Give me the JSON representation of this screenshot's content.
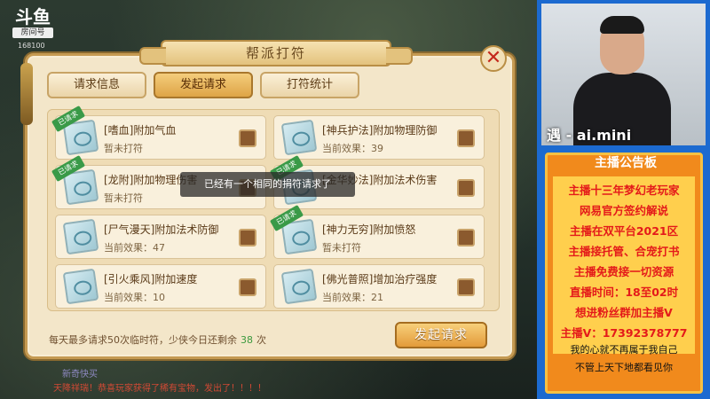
{
  "stream": {
    "logo": "斗鱼",
    "logo_sub": "房间号",
    "room_number": "168100",
    "ticker": "天降祥瑞！恭喜玩家获得了稀有宝物，发出了！！！！",
    "ticker_faint": "新奇快买"
  },
  "dialog": {
    "title": "帮派打符",
    "close_icon": "close-icon",
    "tabs": [
      {
        "label": "请求信息",
        "active": false
      },
      {
        "label": "发起请求",
        "active": true
      },
      {
        "label": "打符统计",
        "active": false
      }
    ],
    "cards": [
      {
        "name": "[嗜血]附加气血",
        "effect": "暂未打符",
        "ribbon": "已请求"
      },
      {
        "name": "[神兵护法]附加物理防御",
        "effect": "当前效果：39",
        "ribbon": ""
      },
      {
        "name": "[龙附]附加物理伤害",
        "effect": "暂未打符",
        "ribbon": "已请求"
      },
      {
        "name": "[金华妙法]附加法术伤害",
        "effect": "",
        "ribbon": "已请求"
      },
      {
        "name": "[尸气漫天]附加法术防御",
        "effect": "当前效果：47",
        "ribbon": ""
      },
      {
        "name": "[神力无穷]附加愤怒",
        "effect": "暂未打符",
        "ribbon": "已请求"
      },
      {
        "name": "[引火乘风]附加速度",
        "effect": "当前效果：10",
        "ribbon": ""
      },
      {
        "name": "[佛光普照]增加治疗强度",
        "effect": "当前效果：21",
        "ribbon": ""
      }
    ],
    "footer_prefix": "每天最多请求50次临时符，少侠今日还剩余",
    "footer_count": "38",
    "footer_suffix": "次",
    "send_button": "发起请求",
    "toast": "已经有一个相同的捐符请求了"
  },
  "sidebar": {
    "webcam_name": "遇 - ai.mini",
    "notice_title": "主播公告板",
    "notice_lines": [
      "主播十三年梦幻老玩家",
      "网易官方签约解说",
      "主播在双平台2021区",
      "主播接托管、合宠打书",
      "主播免费接一切资源",
      "直播时间：18至02时",
      "想进粉丝群加主播V",
      "主播V：17392378777"
    ],
    "notice_foot": [
      "我的心就不再属于我自己",
      "不管上天下地都看见你"
    ]
  }
}
